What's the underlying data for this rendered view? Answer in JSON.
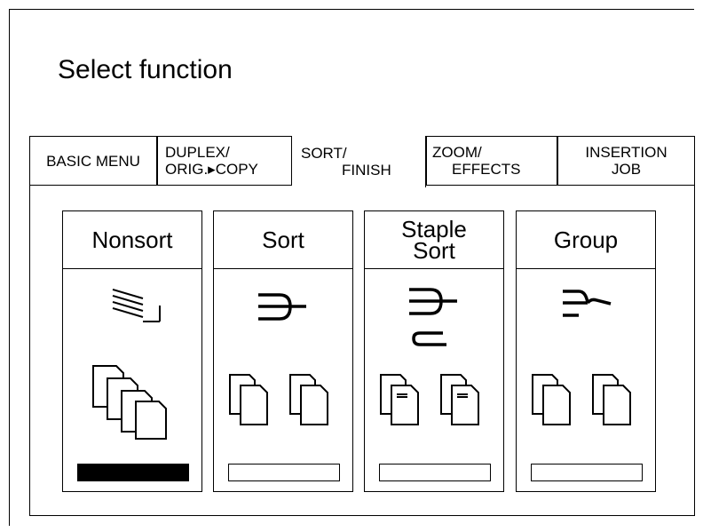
{
  "title": "Select function",
  "tabs": [
    {
      "label": "BASIC MENU",
      "active": false
    },
    {
      "line1": "DUPLEX/",
      "line2": "ORIG.▸COPY",
      "active": false
    },
    {
      "line1": "SORT/",
      "line2": "FINISH",
      "active": true
    },
    {
      "line1": "ZOOM/",
      "line2": "EFFECTS",
      "active": false
    },
    {
      "line1": "INSERTION",
      "line2": "JOB",
      "active": false
    }
  ],
  "options": [
    {
      "label": "Nonsort",
      "selected": true
    },
    {
      "label": "Sort",
      "selected": false
    },
    {
      "label": "Staple\nSort",
      "selected": false
    },
    {
      "label": "Group",
      "selected": false
    }
  ]
}
